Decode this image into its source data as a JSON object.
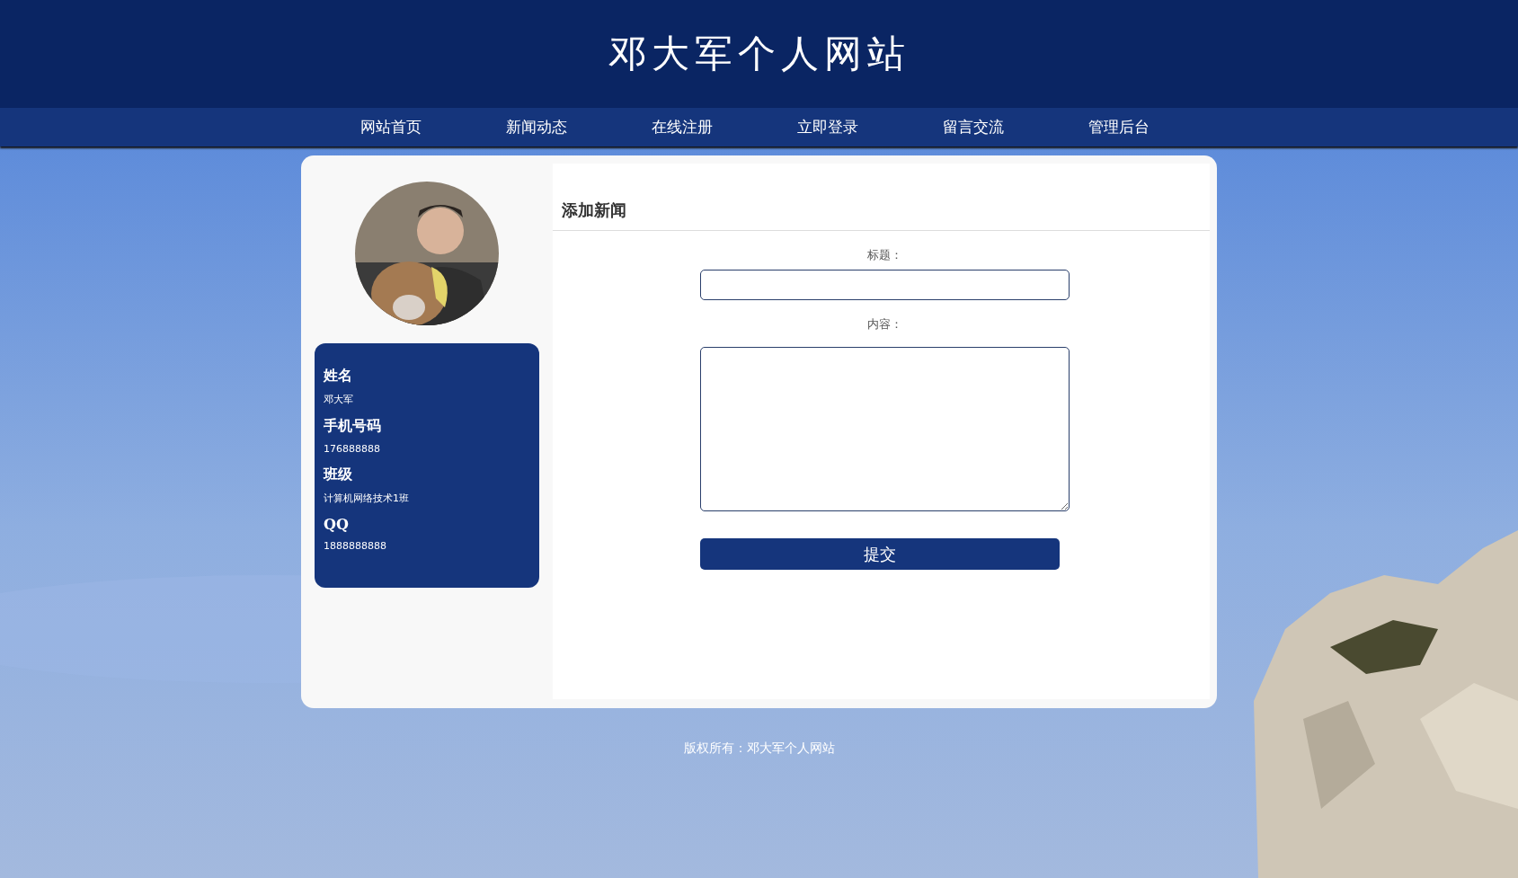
{
  "site_title": "邓大军个人网站",
  "nav": [
    {
      "label": "网站首页"
    },
    {
      "label": "新闻动态"
    },
    {
      "label": "在线注册"
    },
    {
      "label": "立即登录"
    },
    {
      "label": "留言交流"
    },
    {
      "label": "管理后台"
    }
  ],
  "profile": {
    "fields": [
      {
        "label": "姓名",
        "value": "邓大军"
      },
      {
        "label": "手机号码",
        "value": "176888888"
      },
      {
        "label": "班级",
        "value": "计算机网络技术1班"
      },
      {
        "label": "QQ",
        "value": "1888888888"
      }
    ]
  },
  "form": {
    "heading": "添加新闻",
    "title_label": "标题：",
    "content_label": "内容：",
    "submit": "提交"
  },
  "footer": "版权所有：邓大军个人网站"
}
